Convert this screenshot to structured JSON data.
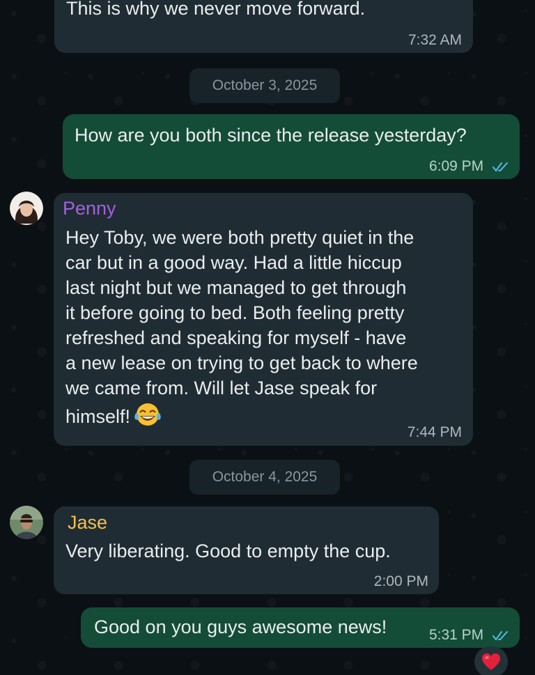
{
  "messages": [
    {
      "text": "This is why we never move forward.",
      "time": "7:32 AM"
    },
    {
      "text": "How are you both since the release yesterday?",
      "time": "6:09 PM"
    },
    {
      "sender": "Penny",
      "text": "Hey Toby, we were both pretty quiet in the\ncar but in a good way. Had a little hiccup\nlast night but we managed to get through\nit before going to bed. Both feeling pretty\nrefreshed and speaking for myself - have\na new lease on trying to get back to where\nwe came from. Will let Jase speak for\nhimself!",
      "time": "7:44 PM",
      "emoji": "tears-of-joy-emoji"
    },
    {
      "sender": "Jase",
      "text": "Very liberating. Good to empty the cup.",
      "time": "2:00 PM"
    },
    {
      "text": "Good on you guys awesome news!",
      "time": "5:31 PM",
      "reaction": "red-heart"
    }
  ],
  "dates": [
    "October 3, 2025",
    "October 4, 2025"
  ],
  "colors": {
    "background": "#0b1014",
    "incoming_bubble": "#202c33",
    "outgoing_bubble": "#144d37",
    "penny_name": "#a55fe3",
    "jase_name": "#f2c14e",
    "read_ticks": "#53bdeb",
    "heart": "#e2223b"
  }
}
